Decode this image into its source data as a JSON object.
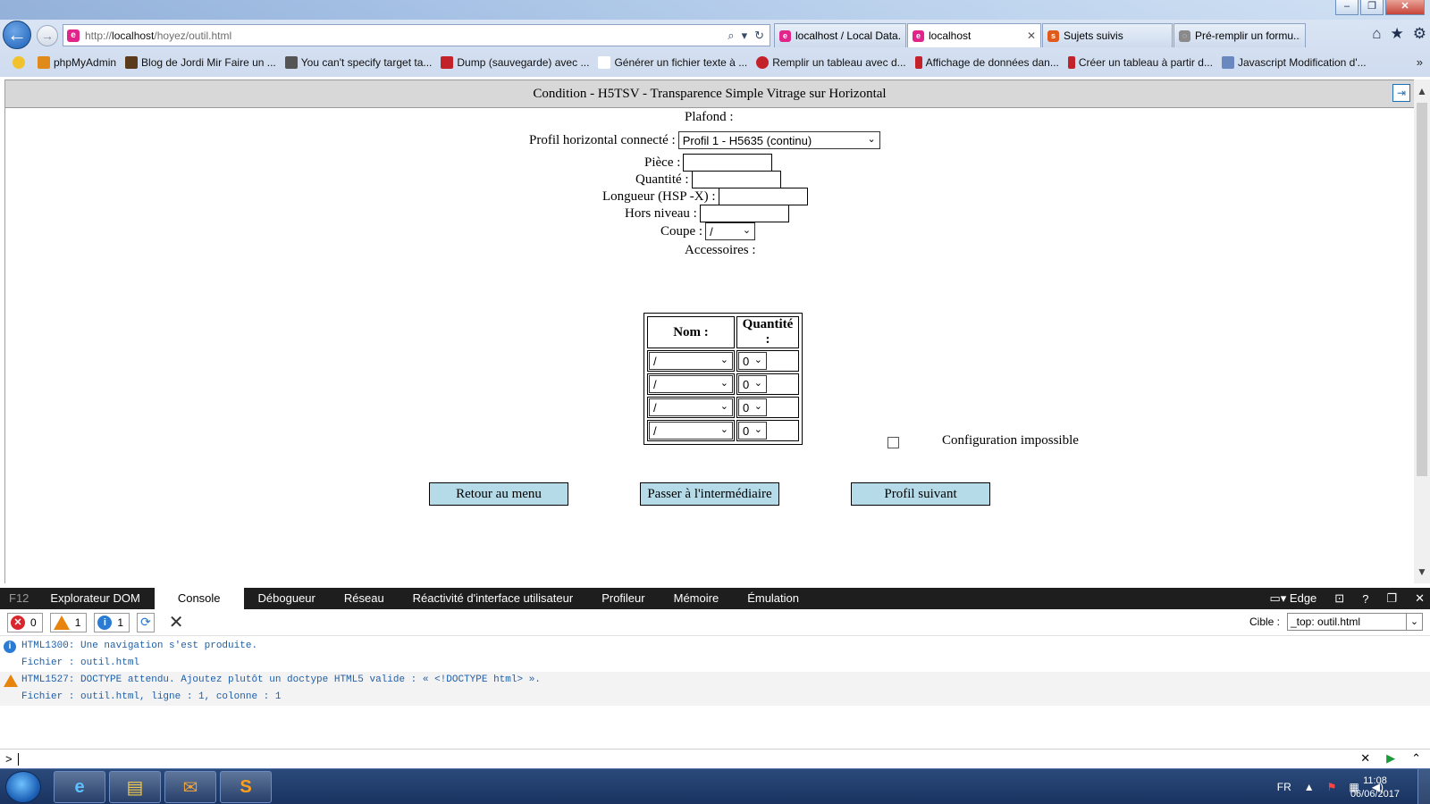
{
  "browser": {
    "url_prefix": "http://",
    "url_host": "localhost",
    "url_path": "/hoyez/outil.html",
    "tabs": [
      {
        "label": "localhost / Local Data...",
        "icon_color": "#e1258b"
      },
      {
        "label": "localhost",
        "icon_color": "#e1258b"
      },
      {
        "label": "Sujets suivis",
        "icon_color": "#e05a1c"
      },
      {
        "label": "Pré-remplir un formu...",
        "icon_color": "#8a8a8a"
      }
    ],
    "favorites": [
      {
        "label": "phpMyAdmin",
        "icon_color": "#e08a1c"
      },
      {
        "label": "Blog de Jordi Mir Faire un ...",
        "icon_color": "#5a3a1a"
      },
      {
        "label": "You can't specify target ta...",
        "icon_color": "#555555"
      },
      {
        "label": "Dump (sauvegarde) avec ...",
        "icon_color": "#c4222a"
      },
      {
        "label": "Générer un fichier texte à ...",
        "icon_color": "#ffffff"
      },
      {
        "label": "Remplir un tableau avec d...",
        "icon_color": "#c4222a"
      },
      {
        "label": "Affichage de données dan...",
        "icon_color": "#c4222a"
      },
      {
        "label": "Créer un tableau à partir d...",
        "icon_color": "#c4222a"
      },
      {
        "label": "Javascript  Modification d'...",
        "icon_color": "#6a88c0"
      }
    ]
  },
  "page": {
    "header_title": "Condition - H5TSV - Transparence Simple Vitrage sur Horizontal",
    "plafond_label": "Plafond :",
    "profil_label": "Profil horizontal connecté :",
    "profil_value": "Profil 1 - H5635 (continu)",
    "piece_label": "Pièce :",
    "quantite_label": "Quantité :",
    "longueur_label": "Longueur (HSP -X) :",
    "hors_niveau_label": "Hors niveau :",
    "coupe_label": "Coupe :",
    "coupe_value": "/",
    "accessoires_label": "Accessoires :",
    "table_headers": [
      "Nom :",
      "Quantité :"
    ],
    "accessory_rows": [
      {
        "nom": "/",
        "quantite": "0"
      },
      {
        "nom": "/",
        "quantite": "0"
      },
      {
        "nom": "/",
        "quantite": "0"
      },
      {
        "nom": "/",
        "quantite": "0"
      }
    ],
    "config_label": "Configuration impossible",
    "buttons": {
      "retour": "Retour au menu",
      "passer": "Passer à l'intermédiaire",
      "suivant": "Profil suivant"
    }
  },
  "devtools": {
    "f12": "F12",
    "tabs": [
      "Explorateur DOM",
      "Console",
      "Débogueur",
      "Réseau",
      "Réactivité d'interface utilisateur",
      "Profileur",
      "Mémoire",
      "Émulation"
    ],
    "active_tab": "Console",
    "mode": "Edge",
    "counts": {
      "errors": "0",
      "warnings": "1",
      "infos": "1"
    },
    "target_label": "Cible :",
    "target_value": "_top: outil.html",
    "messages": [
      {
        "type": "info",
        "line1": "HTML1300: Une navigation s'est produite.",
        "line2": "Fichier : outil.html"
      },
      {
        "type": "warn",
        "line1": "HTML1527: DOCTYPE attendu. Ajoutez plutôt un doctype HTML5 valide : « <!DOCTYPE html> ».",
        "line2": "Fichier : outil.html, ligne : 1, colonne : 1"
      }
    ],
    "prompt": ">"
  },
  "taskbar": {
    "lang": "FR",
    "time": "11:08",
    "date": "06/06/2017"
  }
}
